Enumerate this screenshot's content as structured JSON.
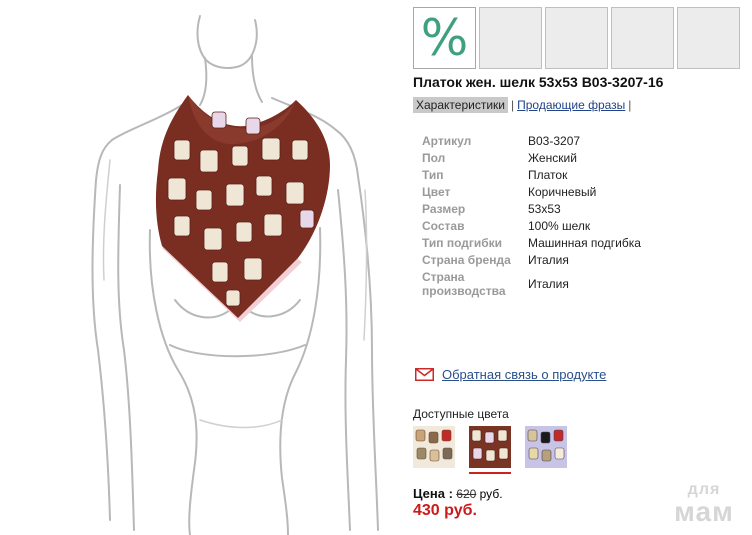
{
  "thumbnails": {
    "active_glyph": "%",
    "count": 5
  },
  "product": {
    "title": "Платок жен. шелк 53x53 B03-3207-16"
  },
  "tabs": {
    "characteristics": "Характеристики",
    "separator": "|",
    "selling_phrases": "Продающие фразы",
    "trailing_separator": "|"
  },
  "specs": [
    {
      "key": "Артикул",
      "value": "B03-3207"
    },
    {
      "key": "Пол",
      "value": "Женский"
    },
    {
      "key": "Тип",
      "value": "Платок"
    },
    {
      "key": "Цвет",
      "value": "Коричневый"
    },
    {
      "key": "Размер",
      "value": "53x53"
    },
    {
      "key": "Состав",
      "value": "100% шелк"
    },
    {
      "key": "Тип подгибки",
      "value": "Машинная подгибка"
    },
    {
      "key": "Страна бренда",
      "value": "Италия"
    },
    {
      "key": "Страна производства",
      "value": "Италия"
    }
  ],
  "feedback": {
    "icon": "envelope-icon",
    "label": "Обратная связь о продукте"
  },
  "colors": {
    "label": "Доступные цвета",
    "swatches": [
      {
        "name": "light",
        "bg": "#f1e9dc"
      },
      {
        "name": "brown",
        "bg": "#7a3424",
        "selected": true
      },
      {
        "name": "lilac",
        "bg": "#c8c4e6"
      }
    ]
  },
  "price": {
    "label": "Цена :",
    "old": "620",
    "old_unit": "руб.",
    "new": "430 руб."
  },
  "watermark": {
    "top": "для",
    "bottom": "мам"
  },
  "theme": {
    "accent_red": "#cc1a1a",
    "percent_green": "#3fa080",
    "scarf_brown": "#7a2e22"
  }
}
